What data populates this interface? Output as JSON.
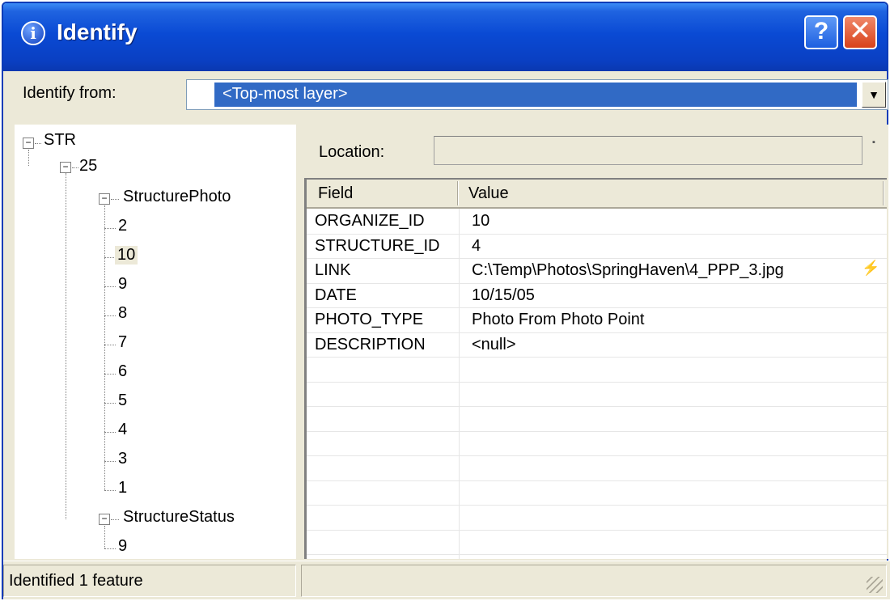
{
  "window": {
    "title": "Identify",
    "icon": "info-icon"
  },
  "controls": {
    "help": "?",
    "close": "✕"
  },
  "identify_from": {
    "label": "Identify from:",
    "value": "<Top-most layer>"
  },
  "tree": {
    "root": "STR",
    "feature": "25",
    "groups": [
      {
        "name": "StructurePhoto",
        "items": [
          "2",
          "10",
          "9",
          "8",
          "7",
          "6",
          "5",
          "4",
          "3",
          "1"
        ],
        "selected": "10"
      },
      {
        "name": "StructureStatus",
        "items": [
          "9"
        ]
      }
    ]
  },
  "location": {
    "label": "Location:",
    "value": ""
  },
  "grid": {
    "headers": [
      "Field",
      "Value"
    ],
    "rows": [
      {
        "field": "ORGANIZE_ID",
        "value": "10"
      },
      {
        "field": "STRUCTURE_ID",
        "value": "4"
      },
      {
        "field": "LINK",
        "value": "C:\\Temp\\Photos\\SpringHaven\\4_PPP_3.jpg",
        "icon": "lightning-hyperlink-icon"
      },
      {
        "field": "DATE",
        "value": "10/15/05"
      },
      {
        "field": "PHOTO_TYPE",
        "value": "Photo From Photo Point"
      },
      {
        "field": "DESCRIPTION",
        "value": "<null>"
      }
    ]
  },
  "status": {
    "text": "Identified 1 feature"
  },
  "colors": {
    "titlebar": "#0a4ad4",
    "selection": "#316ac5",
    "face": "#ece9d8"
  }
}
